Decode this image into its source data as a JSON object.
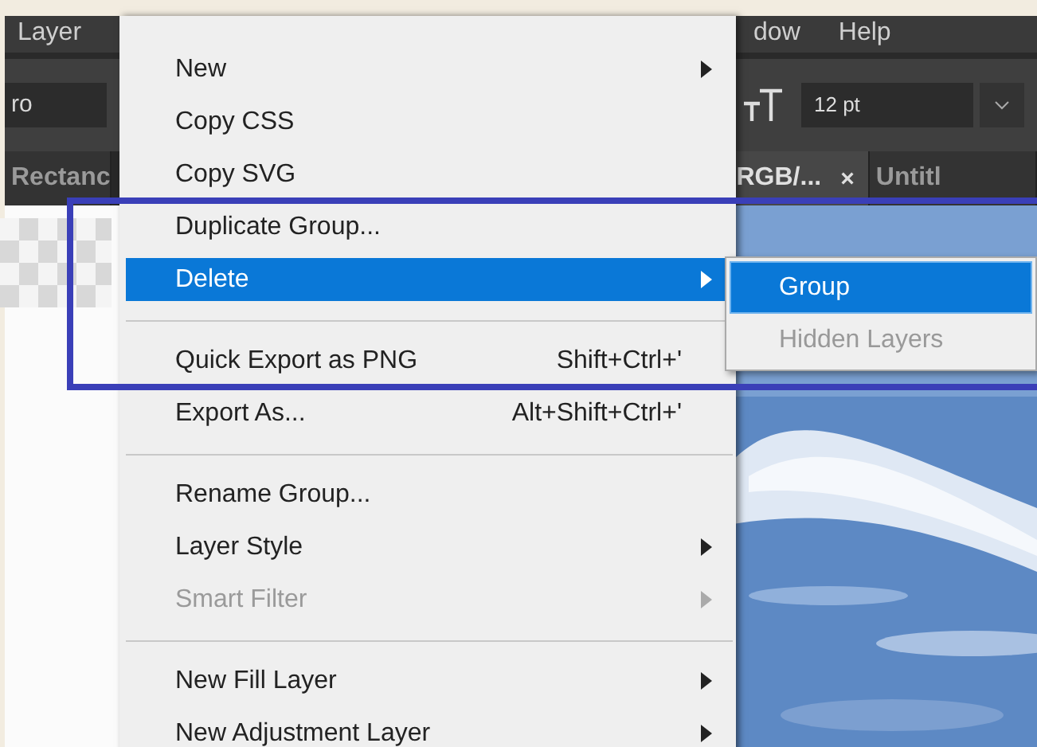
{
  "menu_bar": [
    "Layer",
    "dow",
    "Help"
  ],
  "options_bar": {
    "font_field": "ro",
    "size_field": "12 pt"
  },
  "tabs": [
    {
      "label": "Rectanc",
      "selected": false
    },
    {
      "label": "RGB/...",
      "selected": true,
      "close": "×"
    },
    {
      "label": "Untitl",
      "selected": false
    }
  ],
  "context_menu": [
    [
      {
        "label": "New",
        "submenu": true,
        "disabled": false,
        "selected": false
      },
      {
        "label": "Copy CSS",
        "submenu": false,
        "disabled": false,
        "selected": false
      },
      {
        "label": "Copy SVG",
        "submenu": false,
        "disabled": false,
        "selected": false
      },
      {
        "label": "Duplicate Group...",
        "submenu": false,
        "disabled": false,
        "selected": false
      },
      {
        "label": "Delete",
        "submenu": true,
        "disabled": false,
        "selected": true
      }
    ],
    [
      {
        "label": "Quick Export as PNG",
        "shortcut": "Shift+Ctrl+'",
        "submenu": false,
        "disabled": false,
        "selected": false
      },
      {
        "label": "Export As...",
        "shortcut": "Alt+Shift+Ctrl+'",
        "submenu": false,
        "disabled": false,
        "selected": false
      }
    ],
    [
      {
        "label": "Rename Group...",
        "submenu": false,
        "disabled": false,
        "selected": false
      },
      {
        "label": "Layer Style",
        "submenu": true,
        "disabled": false,
        "selected": false
      },
      {
        "label": "Smart Filter",
        "submenu": true,
        "disabled": true,
        "selected": false
      }
    ],
    [
      {
        "label": "New Fill Layer",
        "submenu": true,
        "disabled": false,
        "selected": false
      },
      {
        "label": "New Adjustment Layer",
        "submenu": true,
        "disabled": false,
        "selected": false
      }
    ]
  ],
  "submenu": [
    {
      "label": "Group",
      "disabled": false,
      "selected": true
    },
    {
      "label": "Hidden Layers",
      "disabled": true,
      "selected": false
    }
  ]
}
